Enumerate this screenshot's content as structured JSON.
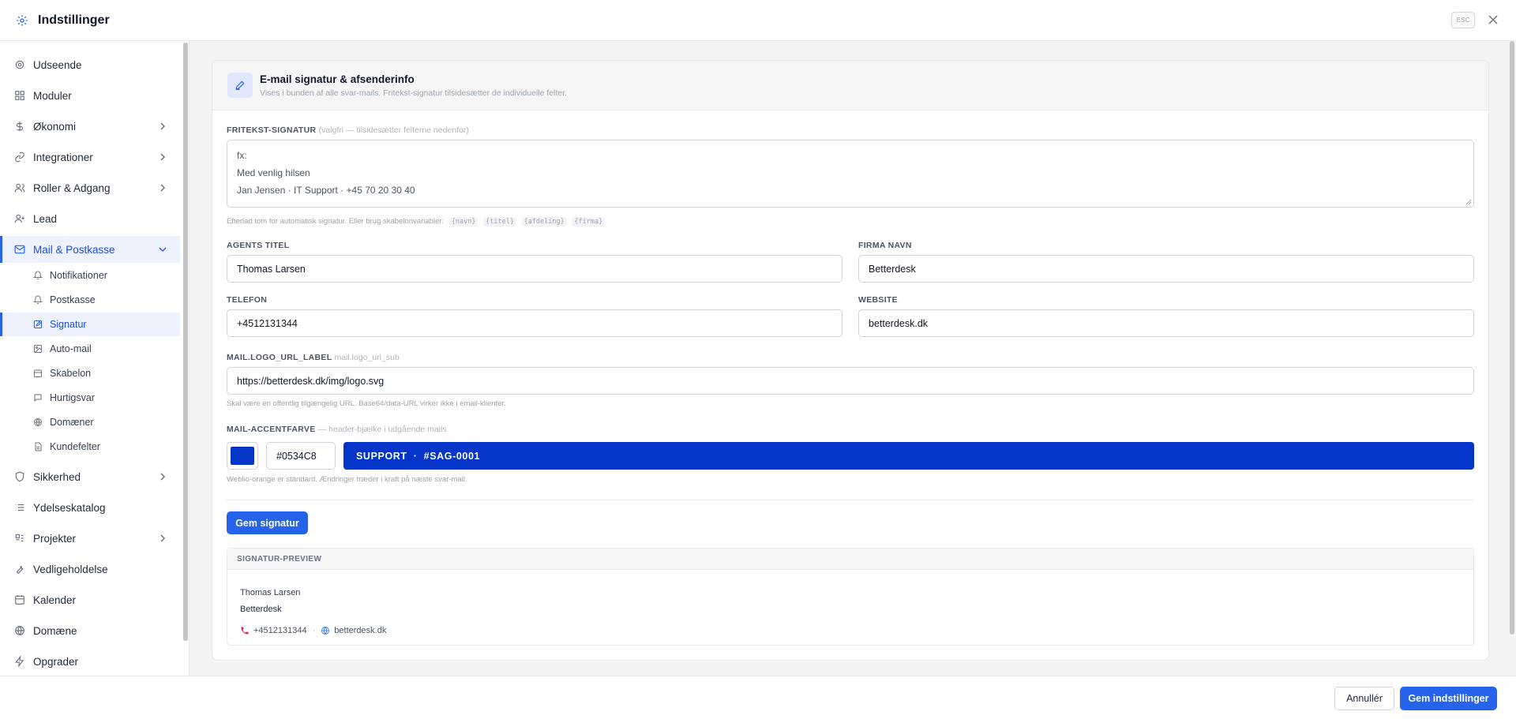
{
  "header": {
    "title": "Indstillinger",
    "esc_label": "ESC"
  },
  "sidebar": {
    "items": [
      {
        "label": "Udseende",
        "icon": "gear-icon"
      },
      {
        "label": "Moduler",
        "icon": "grid-icon"
      },
      {
        "label": "Økonomi",
        "icon": "dollar-icon"
      },
      {
        "label": "Integrationer",
        "icon": "link-icon"
      },
      {
        "label": "Roller & Adgang",
        "icon": "users-icon"
      },
      {
        "label": "Lead",
        "icon": "user-plus-icon"
      },
      {
        "label": "Mail & Postkasse",
        "icon": "mail-icon"
      },
      {
        "label": "Sikkerhed",
        "icon": "shield-icon"
      },
      {
        "label": "Ydelseskatalog",
        "icon": "list-icon"
      },
      {
        "label": "Projekter",
        "icon": "project-icon"
      },
      {
        "label": "Vedligeholdelse",
        "icon": "wrench-icon"
      },
      {
        "label": "Kalender",
        "icon": "calendar-icon"
      },
      {
        "label": "Domæne",
        "icon": "globe-icon"
      },
      {
        "label": "Opgrader",
        "icon": "bolt-icon"
      }
    ],
    "sub_items": [
      {
        "label": "Notifikationer",
        "icon": "bell-icon"
      },
      {
        "label": "Postkasse",
        "icon": "bell-icon"
      },
      {
        "label": "Signatur",
        "icon": "edit-icon"
      },
      {
        "label": "Auto-mail",
        "icon": "image-icon"
      },
      {
        "label": "Skabelon",
        "icon": "calendar-icon"
      },
      {
        "label": "Hurtigsvar",
        "icon": "chat-icon"
      },
      {
        "label": "Domæner",
        "icon": "globe-icon"
      },
      {
        "label": "Kundefelter",
        "icon": "file-icon"
      }
    ]
  },
  "card": {
    "title": "E-mail signatur & afsenderinfo",
    "subtitle": "Vises i bunden af alle svar-mails. Fritekst-signatur tilsidesætter de individuelle felter.",
    "freetext": {
      "label": "FRITEKST-SIGNATUR",
      "label_note": "(valgfri — tilsidesætter felterne nedenfor)",
      "placeholder_lines": [
        "fx:",
        "Med venlig hilsen",
        "Jan Jensen · IT Support · +45 70 20 30 40"
      ],
      "hint": "Efterlad tom for automatisk signatur. Eller brug skabelonvariabler:",
      "vars": [
        "{navn}",
        "{titel}",
        "{afdeling}",
        "{firma}"
      ]
    },
    "agent_title": {
      "label": "AGENTS TITEL",
      "value": "Thomas Larsen"
    },
    "company_name": {
      "label": "FIRMA NAVN",
      "value": "Betterdesk"
    },
    "phone": {
      "label": "TELEFON",
      "value": "+4512131344"
    },
    "website": {
      "label": "WEBSITE",
      "value": "betterdesk.dk"
    },
    "logo_url": {
      "label": "MAIL.LOGO_URL_LABEL",
      "label_note": "mail.logo_url_sub",
      "value": "https://betterdesk.dk/img/logo.svg",
      "hint": "Skal være en offentlig tilgængelig URL. Base64/data-URL virker ikke i email-klienter."
    },
    "accent": {
      "label": "MAIL-ACCENTFARVE",
      "label_note": "— header-bjælke i udgående mails",
      "color": "#0534C8",
      "hex_value": "#0534C8",
      "banner_text": "SUPPORT  ·  #SAG-0001",
      "hint": "Weblio-orange er standard. Ændringer træder i kraft på næste svar-mail."
    },
    "save_label": "Gem signatur",
    "preview": {
      "heading": "SIGNATUR-PREVIEW",
      "name": "Thomas Larsen",
      "company": "Betterdesk",
      "phone": "+4512131344",
      "separator": "·",
      "website": "betterdesk.dk"
    }
  },
  "footer": {
    "cancel_label": "Annullér",
    "save_label": "Gem indstillinger"
  },
  "colors": {
    "primary": "#2563eb",
    "active_bg": "#eef2ff",
    "accent": "#0534C8",
    "phone_icon": "#e11d48"
  }
}
